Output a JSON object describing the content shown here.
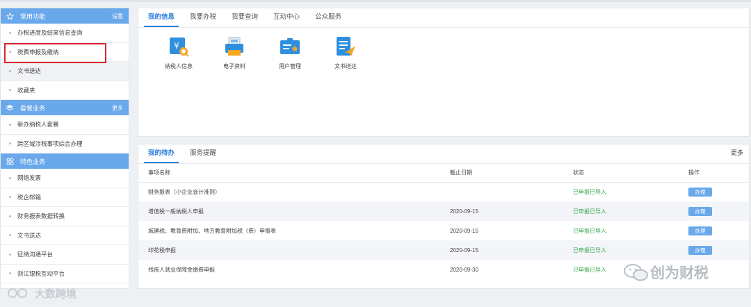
{
  "sidebar": {
    "common": {
      "title": "常用功能",
      "action": "设置",
      "items": [
        {
          "label": "办税进度及结果信息查询"
        },
        {
          "label": "税费申报及缴纳"
        },
        {
          "label": "文书送达"
        },
        {
          "label": "收藏夹"
        }
      ]
    },
    "packages": {
      "title": "套餐业务",
      "action": "更多",
      "items": [
        {
          "label": "新办纳税人套餐"
        },
        {
          "label": "跨区域涉税事项综合办理"
        }
      ]
    },
    "special": {
      "title": "特色业务",
      "items": [
        {
          "label": "网络发票"
        },
        {
          "label": "税企邮箱"
        },
        {
          "label": "财务报表数据转换"
        },
        {
          "label": "文书送达"
        },
        {
          "label": "征纳沟通平台"
        },
        {
          "label": "浙江银税互动平台"
        }
      ]
    }
  },
  "top_panel": {
    "tabs": [
      "我的信息",
      "我要办税",
      "我要查询",
      "互动中心",
      "公众服务"
    ],
    "quick": [
      {
        "label": "纳税人信息",
        "icon": "taxpayer-info-icon"
      },
      {
        "label": "电子资料",
        "icon": "electronic-docs-icon"
      },
      {
        "label": "用户管理",
        "icon": "user-management-icon"
      },
      {
        "label": "文书送达",
        "icon": "document-delivery-icon"
      }
    ]
  },
  "todo_panel": {
    "tabs": [
      "我的待办",
      "服务提醒"
    ],
    "more": "更多",
    "headers": [
      "事项名称",
      "截止日期",
      "状态",
      "操作"
    ],
    "rows": [
      {
        "name": "财务报表（小企业会计准则）",
        "date": "",
        "status": "已申报已导入",
        "action": "办理"
      },
      {
        "name": "增值税一般纳税人申报",
        "date": "2020-09-15",
        "status": "已申报已导入",
        "action": "办理"
      },
      {
        "name": "城建税、教育费附加、地方教育附加税（费）申报表",
        "date": "2020-09-15",
        "status": "已申报已导入",
        "action": "办理"
      },
      {
        "name": "印花税申报",
        "date": "2020-09-15",
        "status": "已申报已导入",
        "action": "办理"
      },
      {
        "name": "残疾人就业保障金缴费申报",
        "date": "2020-09-30",
        "status": "已申报已导入",
        "action": ""
      }
    ]
  },
  "watermarks": {
    "left": "大数跨境",
    "right": "创为财税"
  },
  "colors": {
    "accent": "#6aa8ec",
    "tab_active": "#2f7fd8",
    "status_green": "#36a84a",
    "highlight_red": "#d9262b"
  }
}
